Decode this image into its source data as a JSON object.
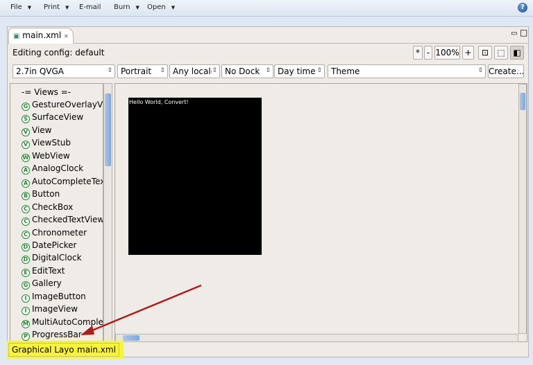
{
  "menu": [
    {
      "label": "File",
      "dropdown": true
    },
    {
      "label": "Print",
      "dropdown": true
    },
    {
      "label": "E-mail",
      "dropdown": false
    },
    {
      "label": "Burn",
      "dropdown": true
    },
    {
      "label": "Open",
      "dropdown": true
    }
  ],
  "help_icon": "question-circle-icon",
  "editor_tab": {
    "label": "main.xml",
    "close": "✕"
  },
  "config_label": "Editing config: default",
  "zoom": {
    "star": "*",
    "minus": "-",
    "level": "100%",
    "plus": "+"
  },
  "combos": {
    "device": "2.7in QVGA",
    "orientation": "Portrait",
    "locale": "Any locale",
    "dock": "No Dock",
    "time": "Day time",
    "theme": "Theme"
  },
  "create_label": "Create...",
  "palette": {
    "header": "-= Views =-",
    "items": [
      {
        "letter": "G",
        "label": "GestureOverlayView"
      },
      {
        "letter": "S",
        "label": "SurfaceView"
      },
      {
        "letter": "V",
        "label": "View"
      },
      {
        "letter": "V",
        "label": "ViewStub"
      },
      {
        "letter": "W",
        "label": "WebView"
      },
      {
        "letter": "A",
        "label": "AnalogClock"
      },
      {
        "letter": "A",
        "label": "AutoCompleteTextView"
      },
      {
        "letter": "B",
        "label": "Button"
      },
      {
        "letter": "C",
        "label": "CheckBox"
      },
      {
        "letter": "C",
        "label": "CheckedTextView"
      },
      {
        "letter": "C",
        "label": "Chronometer"
      },
      {
        "letter": "D",
        "label": "DatePicker"
      },
      {
        "letter": "D",
        "label": "DigitalClock"
      },
      {
        "letter": "E",
        "label": "EditText"
      },
      {
        "letter": "G",
        "label": "Gallery"
      },
      {
        "letter": "I",
        "label": "ImageButton"
      },
      {
        "letter": "I",
        "label": "ImageView"
      },
      {
        "letter": "M",
        "label": "MultiAutoComplete"
      },
      {
        "letter": "P",
        "label": "ProgressBar"
      }
    ]
  },
  "screen_text": "Hello World, Convert!",
  "bottom_tabs": [
    "Graphical Layout",
    "main.xml"
  ],
  "colors": {
    "highlight": "#f7f43c",
    "arrow": "#b01c1c",
    "icon_green": "#1e8a2e"
  }
}
